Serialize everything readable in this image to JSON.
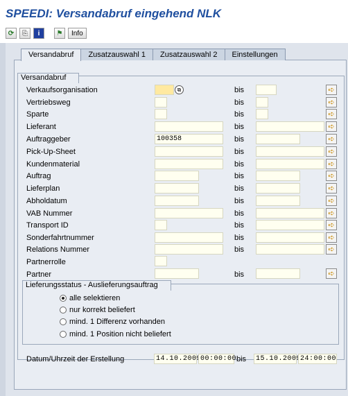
{
  "title": "SPEEDI: Versandabruf eingehend NLK",
  "toolbar": {
    "info_label": "Info"
  },
  "tabs": [
    "Versandabruf",
    "Zusatzauswahl 1",
    "Zusatzauswahl 2",
    "Einstellungen"
  ],
  "group_title": "Versandabruf",
  "bis_label": "bis",
  "fields": [
    {
      "label": "Verkaufsorganisation",
      "value": "",
      "to": ""
    },
    {
      "label": "Vertriebsweg",
      "value": "",
      "to": ""
    },
    {
      "label": "Sparte",
      "value": "",
      "to": ""
    },
    {
      "label": "Lieferant",
      "value": "",
      "to": ""
    },
    {
      "label": "Auftraggeber",
      "value": "100358",
      "to": ""
    },
    {
      "label": "Pick-Up-Sheet",
      "value": "",
      "to": ""
    },
    {
      "label": "Kundenmaterial",
      "value": "",
      "to": ""
    },
    {
      "label": "Auftrag",
      "value": "",
      "to": ""
    },
    {
      "label": "Lieferplan",
      "value": "",
      "to": ""
    },
    {
      "label": "Abholdatum",
      "value": "",
      "to": ""
    },
    {
      "label": "VAB Nummer",
      "value": "",
      "to": ""
    },
    {
      "label": "Transport ID",
      "value": "",
      "to": ""
    },
    {
      "label": "Sonderfahrtnummer",
      "value": "",
      "to": ""
    },
    {
      "label": "Relations Nummer",
      "value": "",
      "to": ""
    },
    {
      "label": "Partnerrolle",
      "value": ""
    },
    {
      "label": "Partner",
      "value": "",
      "to": ""
    }
  ],
  "status_group": {
    "title": "Lieferungsstatus - Auslieferungsauftrag",
    "options": [
      "alle selektieren",
      "nur korrekt beliefert",
      "mind. 1 Differenz vorhanden",
      "mind. 1 Position nicht beliefert"
    ],
    "selected": "alle selektieren"
  },
  "creation": {
    "label": "Datum/Uhrzeit der Erstellung",
    "from_date": "14.10.2009",
    "from_time": "00:00:00",
    "bis": "bis",
    "to_date": "15.10.2009",
    "to_time": "24:00:00"
  },
  "icons": [
    "execute-icon",
    "variant-icon",
    "info-icon",
    "flag-icon",
    "help-icon",
    "multiple-selection-arrow-icon"
  ],
  "colors": {
    "title": "#1f4f9f",
    "background": "#e9edf3",
    "required_field": "#ffe9a0",
    "arrow": "#c88800"
  }
}
